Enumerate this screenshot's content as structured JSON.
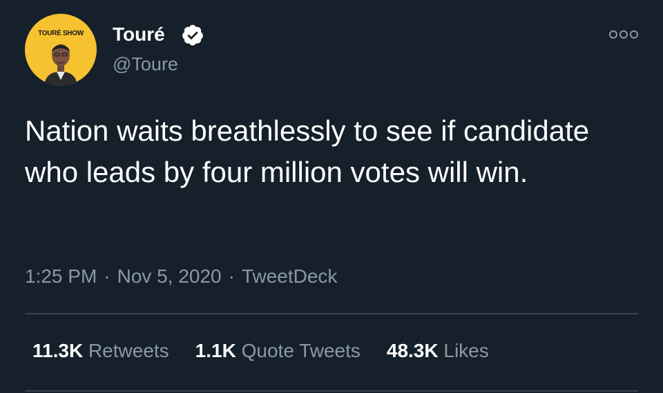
{
  "author": {
    "avatar_brand": "TOURÉ SHOW",
    "avatar_color": "#f7c22f",
    "display_name": "Touré",
    "handle": "@Toure",
    "verified": true
  },
  "tweet": {
    "text": "Nation waits breathlessly to see if candidate who leads by four million votes will win.",
    "time": "1:25 PM",
    "date": "Nov 5, 2020",
    "source": "TweetDeck",
    "separator": "·"
  },
  "stats": [
    {
      "count": "11.3K",
      "label": "Retweets"
    },
    {
      "count": "1.1K",
      "label": "Quote Tweets"
    },
    {
      "count": "48.3K",
      "label": "Likes"
    }
  ],
  "icons": {
    "verified": "verified-badge-icon",
    "more": "more-options-icon"
  },
  "colors": {
    "background": "#15202b",
    "primary_text": "#ffffff",
    "secondary_text": "#8b98a5",
    "divider": "#38444d"
  }
}
